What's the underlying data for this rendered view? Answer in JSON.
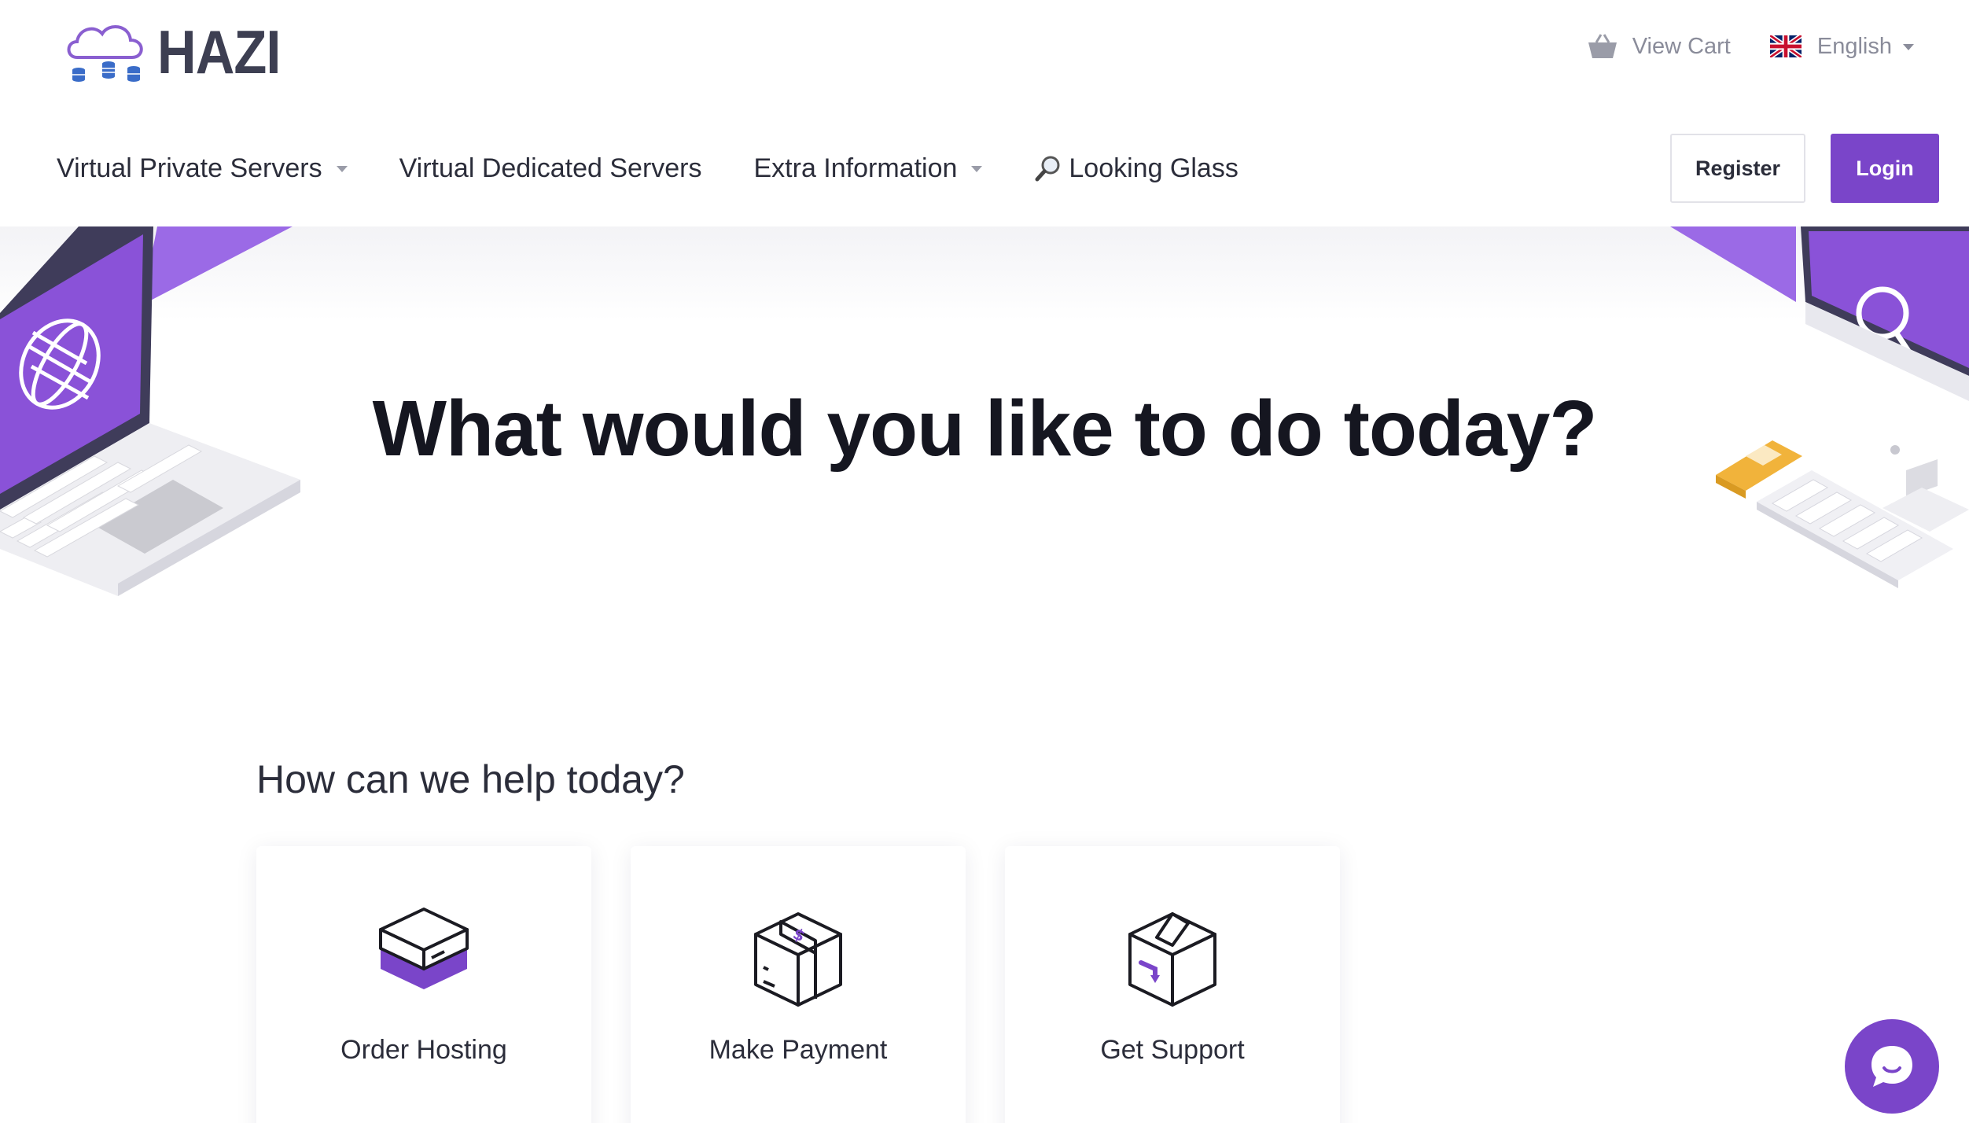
{
  "brand": {
    "name": "HAZI",
    "accent": "#7a45c9",
    "logo_icon": "cloud-database-icon"
  },
  "topbar": {
    "cart_label": "View Cart",
    "cart_icon": "basket-icon",
    "language": "English",
    "language_flag": "uk-flag-icon"
  },
  "nav": {
    "items": [
      {
        "label": "Virtual Private Servers",
        "dropdown": true
      },
      {
        "label": "Virtual Dedicated Servers",
        "dropdown": false
      },
      {
        "label": "Extra Information",
        "dropdown": true
      },
      {
        "label": "Looking Glass",
        "dropdown": false,
        "icon": "magnifier-icon"
      }
    ],
    "register_label": "Register",
    "login_label": "Login"
  },
  "hero": {
    "title": "What would you like to do today?",
    "left_illustration": "laptop-globe-illustration",
    "right_illustration": "desktop-search-illustration"
  },
  "help": {
    "title": "How can we help today?",
    "cards": [
      {
        "label": "Order Hosting",
        "icon": "server-box-icon"
      },
      {
        "label": "Make Payment",
        "icon": "payment-package-icon"
      },
      {
        "label": "Get Support",
        "icon": "support-box-icon"
      }
    ]
  },
  "chat": {
    "icon": "chat-bubble-icon"
  }
}
